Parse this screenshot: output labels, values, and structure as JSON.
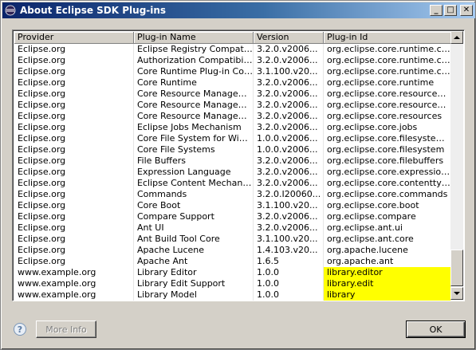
{
  "window": {
    "title": "About Eclipse SDK Plug-ins",
    "minimize_symbol": "_",
    "maximize_symbol": "□",
    "close_symbol": "✕"
  },
  "table": {
    "columns": [
      "Provider",
      "Plug-in Name",
      "Version",
      "Plug-in Id"
    ],
    "rows": [
      {
        "provider": "Eclipse.org",
        "name": "Eclipse Registry Compatibi...",
        "version": "3.2.0.v2006...",
        "id": "org.eclipse.core.runtime.co...",
        "highlight": false
      },
      {
        "provider": "Eclipse.org",
        "name": "Authorization Compatibilit...",
        "version": "3.2.0.v2006...",
        "id": "org.eclipse.core.runtime.co...",
        "highlight": false
      },
      {
        "provider": "Eclipse.org",
        "name": "Core Runtime Plug-in Com...",
        "version": "3.1.100.v20...",
        "id": "org.eclipse.core.runtime.co...",
        "highlight": false
      },
      {
        "provider": "Eclipse.org",
        "name": "Core Runtime",
        "version": "3.2.0.v2006...",
        "id": "org.eclipse.core.runtime",
        "highlight": false
      },
      {
        "provider": "Eclipse.org",
        "name": "Core Resource Manageme...",
        "version": "3.2.0.v2006...",
        "id": "org.eclipse.core.resources....",
        "highlight": false
      },
      {
        "provider": "Eclipse.org",
        "name": "Core Resource Manageme...",
        "version": "3.2.0.v2006...",
        "id": "org.eclipse.core.resources.c...",
        "highlight": false
      },
      {
        "provider": "Eclipse.org",
        "name": "Core Resource Management",
        "version": "3.2.0.v2006...",
        "id": "org.eclipse.core.resources",
        "highlight": false
      },
      {
        "provider": "Eclipse.org",
        "name": "Eclipse Jobs Mechanism",
        "version": "3.2.0.v2006...",
        "id": "org.eclipse.core.jobs",
        "highlight": false
      },
      {
        "provider": "Eclipse.org",
        "name": "Core File System for Wind...",
        "version": "1.0.0.v2006...",
        "id": "org.eclipse.core.filesystem....",
        "highlight": false
      },
      {
        "provider": "Eclipse.org",
        "name": "Core File Systems",
        "version": "1.0.0.v2006...",
        "id": "org.eclipse.core.filesystem",
        "highlight": false
      },
      {
        "provider": "Eclipse.org",
        "name": "File Buffers",
        "version": "3.2.0.v2006...",
        "id": "org.eclipse.core.filebuffers",
        "highlight": false
      },
      {
        "provider": "Eclipse.org",
        "name": "Expression Language",
        "version": "3.2.0.v2006...",
        "id": "org.eclipse.core.expressions",
        "highlight": false
      },
      {
        "provider": "Eclipse.org",
        "name": "Eclipse Content Mechanism",
        "version": "3.2.0.v2006...",
        "id": "org.eclipse.core.contenttype",
        "highlight": false
      },
      {
        "provider": "Eclipse.org",
        "name": "Commands",
        "version": "3.2.0.I20060...",
        "id": "org.eclipse.core.commands",
        "highlight": false
      },
      {
        "provider": "Eclipse.org",
        "name": "Core Boot",
        "version": "3.1.100.v20...",
        "id": "org.eclipse.core.boot",
        "highlight": false
      },
      {
        "provider": "Eclipse.org",
        "name": "Compare Support",
        "version": "3.2.0.v2006...",
        "id": "org.eclipse.compare",
        "highlight": false
      },
      {
        "provider": "Eclipse.org",
        "name": "Ant UI",
        "version": "3.2.0.v2006...",
        "id": "org.eclipse.ant.ui",
        "highlight": false
      },
      {
        "provider": "Eclipse.org",
        "name": "Ant Build Tool Core",
        "version": "3.1.100.v20...",
        "id": "org.eclipse.ant.core",
        "highlight": false
      },
      {
        "provider": "Eclipse.org",
        "name": "Apache Lucene",
        "version": "1.4.103.v20...",
        "id": "org.apache.lucene",
        "highlight": false
      },
      {
        "provider": "Eclipse.org",
        "name": "Apache Ant",
        "version": "1.6.5",
        "id": "org.apache.ant",
        "highlight": false
      },
      {
        "provider": "www.example.org",
        "name": "Library Editor",
        "version": "1.0.0",
        "id": "library.editor",
        "highlight": true
      },
      {
        "provider": "www.example.org",
        "name": "Library Edit Support",
        "version": "1.0.0",
        "id": "library.edit",
        "highlight": true
      },
      {
        "provider": "www.example.org",
        "name": "Library Model",
        "version": "1.0.0",
        "id": "library",
        "highlight": true
      }
    ],
    "highlight_color": "#ffff00"
  },
  "buttons": {
    "help_symbol": "?",
    "more_info": "More Info",
    "ok": "OK"
  }
}
